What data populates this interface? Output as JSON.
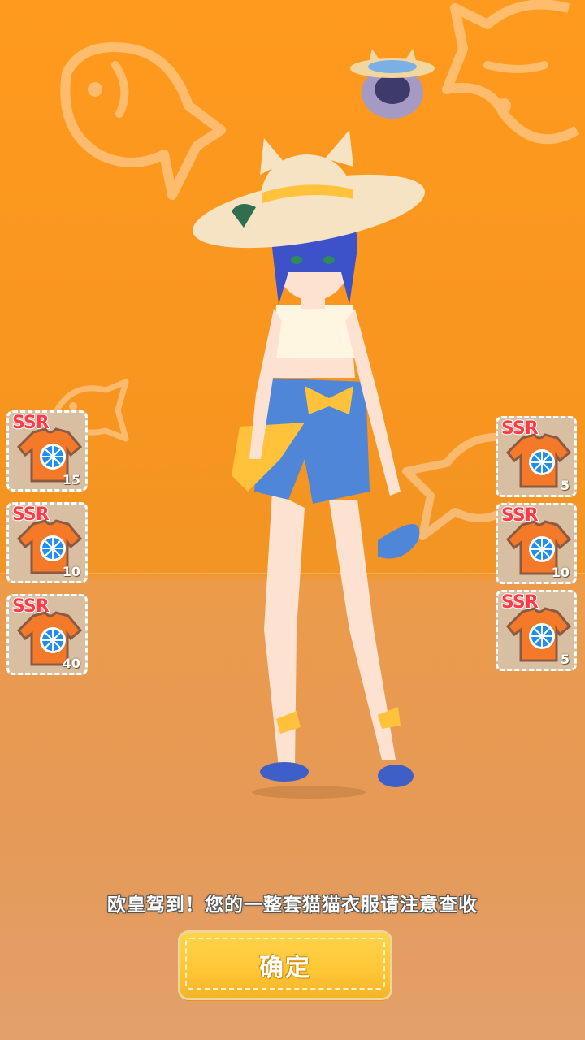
{
  "prompt": {
    "text": "欧皇驾到！您的一整套猫猫衣服请注意查收"
  },
  "confirm_button": {
    "label": "确定"
  },
  "rewards_left": [
    {
      "rarity": "SSR",
      "icon": "orange-tshirt-icon",
      "count": "15"
    },
    {
      "rarity": "SSR",
      "icon": "orange-tshirt-icon",
      "count": "10"
    },
    {
      "rarity": "SSR",
      "icon": "orange-tshirt-icon",
      "count": "40"
    }
  ],
  "rewards_right": [
    {
      "rarity": "SSR",
      "icon": "orange-tshirt-icon",
      "count": "5"
    },
    {
      "rarity": "SSR",
      "icon": "orange-tshirt-icon",
      "count": "10"
    },
    {
      "rarity": "SSR",
      "icon": "orange-tshirt-icon",
      "count": "5"
    }
  ],
  "colors": {
    "background": "#f7951f",
    "button": "#ffc636",
    "ssr": "#ff3b4a"
  }
}
